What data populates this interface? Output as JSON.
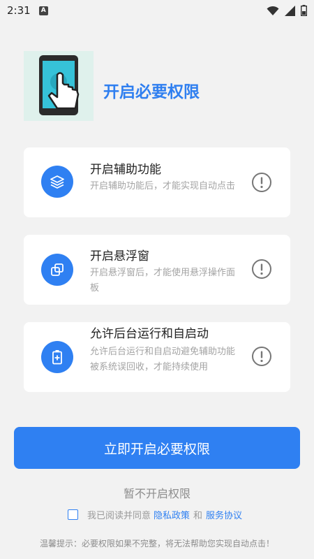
{
  "status": {
    "time": "2:31",
    "notif": "A"
  },
  "header": {
    "title": "开启必要权限"
  },
  "cards": [
    {
      "title": "开启辅助功能",
      "desc": "开启辅助功能后，才能实现自动点击",
      "icon": "layers-icon"
    },
    {
      "title": "开启悬浮窗",
      "desc": "开启悬浮窗后，才能使用悬浮操作面板",
      "icon": "overlay-windows-icon"
    },
    {
      "title": "允许后台运行和自启动",
      "desc": "允许后台运行和自启动避免辅助功能被系统误回收，才能持续使用",
      "icon": "battery-plus-icon"
    }
  ],
  "actions": {
    "primary": "立即开启必要权限",
    "skip": "暂不开启权限"
  },
  "agreement": {
    "prefix": "我已阅读并同意",
    "privacy": "隐私政策",
    "and": "和",
    "terms": "服务协议",
    "checked": false
  },
  "tip": "温馨提示：必要权限如果不完整，将无法帮助您实现自动点击！",
  "colors": {
    "accent": "#2f80f2",
    "background": "#f2f2f2"
  }
}
